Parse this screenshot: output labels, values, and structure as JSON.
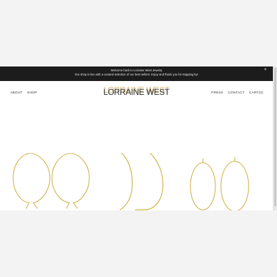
{
  "announcement": {
    "line1": "Welcome back to Lorraine West Jewelry",
    "line2": "Our shop is live with a curated selection of our best sellers.  Enjoy and thank you for stopping by!",
    "close_label": "×"
  },
  "nav": {
    "left": [
      "ABOUT",
      "SHOP"
    ],
    "right": [
      "PRESS",
      "CONTACT",
      "CART(0)"
    ]
  },
  "brand": {
    "logo_text": "LORRAINE WEST",
    "logo_shadow_text": "LORRAINE WEST"
  },
  "products": [
    {
      "name": "gold-hoop-earrings-1",
      "icon": "hoop-earring-icon"
    },
    {
      "name": "gold-hoop-earrings-2",
      "icon": "hoop-earring-icon"
    },
    {
      "name": "gold-hoop-earrings-3",
      "icon": "hoop-earring-icon"
    }
  ],
  "colors": {
    "gold": "#d4b24c",
    "bar": "#1c1c1c",
    "background": "#ffffff"
  }
}
